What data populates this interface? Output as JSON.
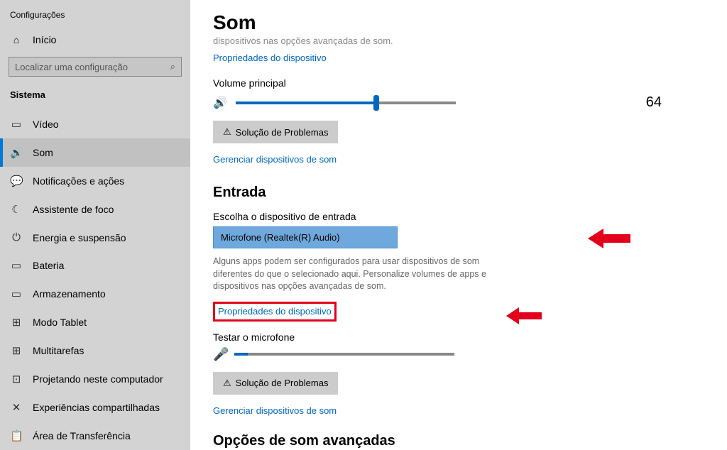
{
  "sidebar": {
    "title": "Configurações",
    "home": "Início",
    "search_placeholder": "Localizar uma configuração",
    "section": "Sistema",
    "items": [
      {
        "icon": "▭",
        "label": "Vídeo"
      },
      {
        "icon": "🔊",
        "label": "Som"
      },
      {
        "icon": "💬",
        "label": "Notificações e ações"
      },
      {
        "icon": "☾",
        "label": "Assistente de foco"
      },
      {
        "icon": "⏻",
        "label": "Energia e suspensão"
      },
      {
        "icon": "▭",
        "label": "Bateria"
      },
      {
        "icon": "▭",
        "label": "Armazenamento"
      },
      {
        "icon": "⊞",
        "label": "Modo Tablet"
      },
      {
        "icon": "⊞",
        "label": "Multitarefas"
      },
      {
        "icon": "⊡",
        "label": "Projetando neste computador"
      },
      {
        "icon": "✕",
        "label": "Experiências compartilhadas"
      },
      {
        "icon": "📋",
        "label": "Área de Transferência"
      }
    ]
  },
  "main": {
    "title": "Som",
    "faded": "dispositivos nas opções avançadas de som.",
    "device_props": "Propriedades do dispositivo",
    "vol_label": "Volume principal",
    "vol_value": "64",
    "troubleshoot": "Solução de Problemas",
    "manage": "Gerenciar dispositivos de som",
    "input_h": "Entrada",
    "input_choose": "Escolha o dispositivo de entrada",
    "input_device": "Microfone (Realtek(R) Audio)",
    "input_desc": "Alguns apps podem ser configurados para usar dispositivos de som diferentes do que o selecionado aqui. Personalize volumes de apps e dispositivos nas opções avançadas de som.",
    "test_mic": "Testar o microfone",
    "advanced_h": "Opções de som avançadas"
  }
}
